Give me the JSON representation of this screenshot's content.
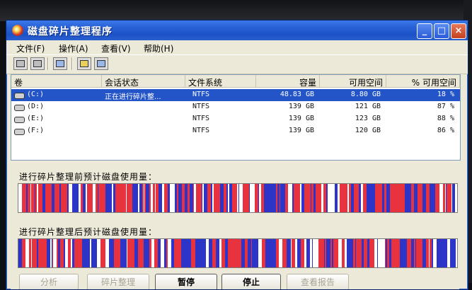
{
  "window": {
    "title": "磁盘碎片整理程序",
    "controls": [
      "_",
      "□",
      "×"
    ]
  },
  "menu": [
    {
      "label": "文件(F)"
    },
    {
      "label": "操作(A)"
    },
    {
      "label": "查看(V)"
    },
    {
      "label": "帮助(H)"
    }
  ],
  "table": {
    "headers": [
      "卷",
      "会话状态",
      "文件系统",
      "容量",
      "可用空间",
      "% 可用空间"
    ],
    "rows": [
      {
        "volume": "(C:)",
        "status": "正在进行碎片整...",
        "fs": "NTFS",
        "capacity": "48.83 GB",
        "free": "8.80 GB",
        "pct": "18 %"
      },
      {
        "volume": "(D:)",
        "status": "",
        "fs": "NTFS",
        "capacity": "139 GB",
        "free": "121 GB",
        "pct": "87 %"
      },
      {
        "volume": "(E:)",
        "status": "",
        "fs": "NTFS",
        "capacity": "139 GB",
        "free": "123 GB",
        "pct": "88 %"
      },
      {
        "volume": "(F:)",
        "status": "",
        "fs": "NTFS",
        "capacity": "139 GB",
        "free": "120 GB",
        "pct": "86 %"
      }
    ]
  },
  "estimates": {
    "before_label": "进行碎片整理前预计磁盘使用量：",
    "after_label": "进行碎片整理后预计磁盘使用量："
  },
  "colors": {
    "fragmented": "#e8333e",
    "contiguous": "#2c35c8",
    "free": "#ffffff",
    "selection": "#2455c8"
  },
  "buttons": [
    {
      "label": "分析",
      "enabled": false
    },
    {
      "label": "碎片整理",
      "enabled": false
    },
    {
      "label": "暂停",
      "enabled": true
    },
    {
      "label": "停止",
      "enabled": true
    },
    {
      "label": "查看报告",
      "enabled": false
    }
  ]
}
